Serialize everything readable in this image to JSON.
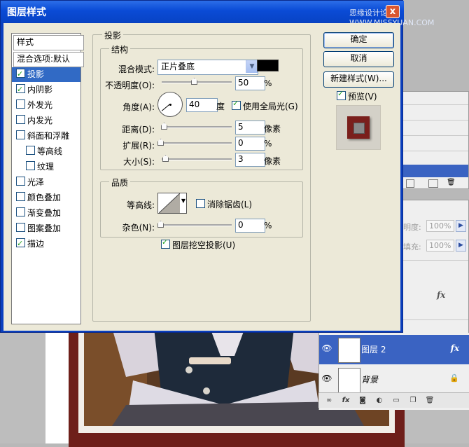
{
  "dialog": {
    "title": "图层样式",
    "watermark": "思缘设计论坛 WWW.MISSYUAN.COM",
    "close_label": "x"
  },
  "style_list": {
    "header": "样式",
    "blend_header": "混合选项:默认",
    "items": [
      {
        "label": "投影",
        "checked": true,
        "selected": true,
        "sub": false
      },
      {
        "label": "内阴影",
        "checked": true,
        "selected": false,
        "sub": false
      },
      {
        "label": "外发光",
        "checked": false,
        "selected": false,
        "sub": false
      },
      {
        "label": "内发光",
        "checked": false,
        "selected": false,
        "sub": false
      },
      {
        "label": "斜面和浮雕",
        "checked": false,
        "selected": false,
        "sub": false
      },
      {
        "label": "等高线",
        "checked": false,
        "selected": false,
        "sub": true
      },
      {
        "label": "纹理",
        "checked": false,
        "selected": false,
        "sub": true
      },
      {
        "label": "光泽",
        "checked": false,
        "selected": false,
        "sub": false
      },
      {
        "label": "颜色叠加",
        "checked": false,
        "selected": false,
        "sub": false
      },
      {
        "label": "渐变叠加",
        "checked": false,
        "selected": false,
        "sub": false
      },
      {
        "label": "图案叠加",
        "checked": false,
        "selected": false,
        "sub": false
      },
      {
        "label": "描边",
        "checked": true,
        "selected": false,
        "sub": false
      }
    ]
  },
  "drop_shadow": {
    "group_title": "投影",
    "structure_title": "结构",
    "blend_mode_label": "混合模式:",
    "blend_mode_value": "正片叠底",
    "color_swatch": "#000000",
    "opacity_label": "不透明度(O):",
    "opacity_value": "50",
    "opacity_unit": "%",
    "angle_label": "角度(A):",
    "angle_value": "40",
    "angle_unit": "度",
    "global_light_label": "使用全局光(G)",
    "global_light_checked": true,
    "distance_label": "距离(D):",
    "distance_value": "5",
    "distance_unit": "像素",
    "spread_label": "扩展(R):",
    "spread_value": "0",
    "spread_unit": "%",
    "size_label": "大小(S):",
    "size_value": "3",
    "size_unit": "像素",
    "quality_title": "品质",
    "contour_label": "等高线:",
    "anti_alias_label": "消除锯齿(L)",
    "anti_alias_checked": false,
    "noise_label": "杂色(N):",
    "noise_value": "0",
    "noise_unit": "%",
    "knockout_label": "图层挖空投影(U)",
    "knockout_checked": true
  },
  "buttons": {
    "ok": "确定",
    "cancel": "取消",
    "new_style": "新建样式(W)...",
    "preview_label": "预览(V)",
    "preview_checked": true
  },
  "layers_panel": {
    "opacity_label": "明度:",
    "opacity_value": "100%",
    "fill_label": "填充:",
    "fill_value": "100%",
    "fx_label": "fx",
    "layers": [
      {
        "name": "图层 2",
        "selected": true,
        "fx": true,
        "locked": false
      },
      {
        "name": "背景",
        "selected": false,
        "fx": false,
        "locked": true
      }
    ]
  },
  "colors": {
    "title_bar": "#0a4bd6",
    "selection": "#316ac5",
    "frame": "#6e1f1a"
  }
}
